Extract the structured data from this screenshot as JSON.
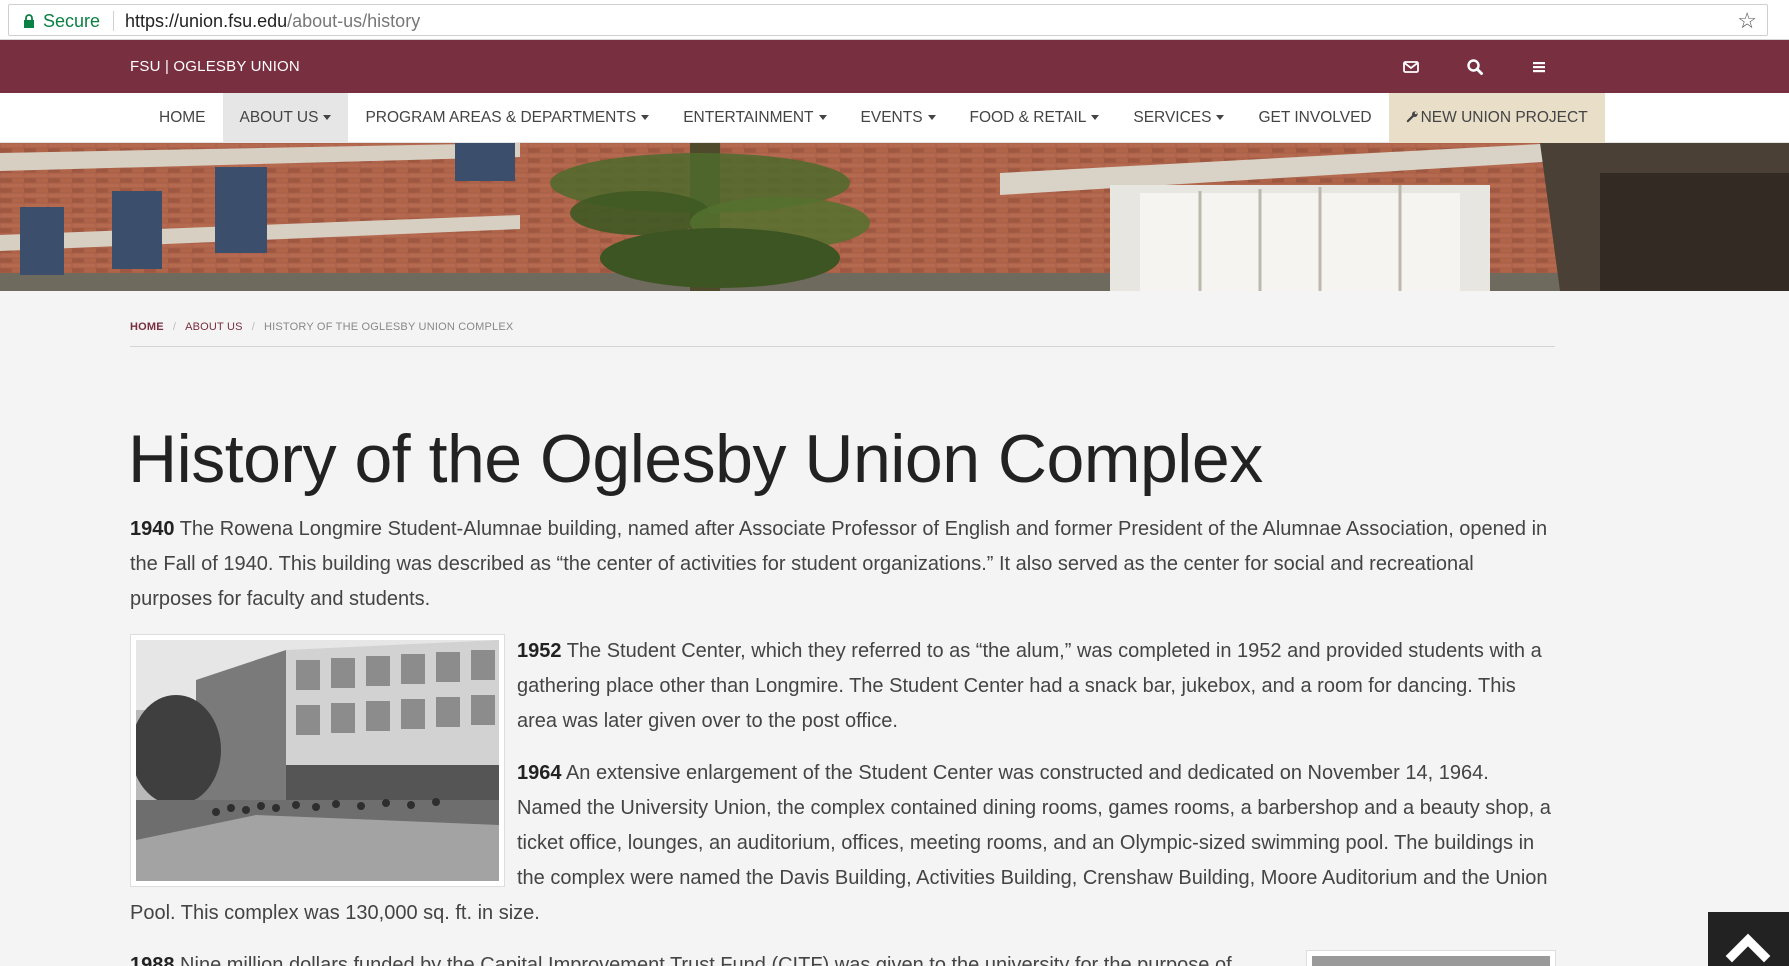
{
  "browser": {
    "secure_label": "Secure",
    "url_host": "https://union.fsu.edu",
    "url_path": "/about-us/history"
  },
  "topbar": {
    "brand": "FSU | OGLESBY UNION"
  },
  "nav": {
    "items": [
      {
        "label": "HOME"
      },
      {
        "label": "ABOUT US"
      },
      {
        "label": "PROGRAM AREAS & DEPARTMENTS"
      },
      {
        "label": "ENTERTAINMENT"
      },
      {
        "label": "EVENTS"
      },
      {
        "label": "FOOD & RETAIL"
      },
      {
        "label": "SERVICES"
      },
      {
        "label": "GET INVOLVED"
      },
      {
        "label": "NEW UNION PROJECT"
      }
    ]
  },
  "breadcrumb": {
    "home": "HOME",
    "about": "ABOUT US",
    "current": "HISTORY OF THE OGLESBY UNION COMPLEX"
  },
  "page": {
    "title": "History of the Oglesby Union Complex",
    "entries": [
      {
        "year": "1940",
        "text": " The Rowena Longmire Student-Alumnae building, named after Associate Professor of English and former President of the Alumnae Association, opened in the Fall of 1940. This building was described as “the center of activities for student organizations.” It also served as the center for social and recreational purposes for faculty and students."
      },
      {
        "year": "1952",
        "text": " The Student Center, which they referred to as “the alum,” was completed in 1952 and provided students with a gathering place other than Longmire. The Student Center had a snack bar, jukebox, and a room for dancing. This area was later given over to the post office."
      },
      {
        "year": "1964",
        "text": " An extensive enlargement of the Student Center was constructed and dedicated on November 14, 1964. Named the University Union, the complex contained dining rooms, games rooms, a barbershop and a beauty shop, a ticket office, lounges, an auditorium, offices, meeting rooms, and an Olympic-sized swimming pool. The buildings in the complex were named the Davis Building, Activities Building, Crenshaw Building, Moore Auditorium and the Union Pool. This complex was 130,000 sq. ft. in size."
      },
      {
        "year": "1988",
        "text": " Nine million dollars funded by the Capital Improvement Trust Fund (CITF) was given to the university for the purpose of"
      }
    ]
  },
  "colors": {
    "maroon": "#782f40",
    "gold_tab": "#e9dfc9"
  },
  "icons": {
    "mail": "envelope-icon",
    "search": "search-icon",
    "menu": "hamburger-menu-icon",
    "wrench": "wrench-icon",
    "to_top": "chevron-up-icon"
  }
}
